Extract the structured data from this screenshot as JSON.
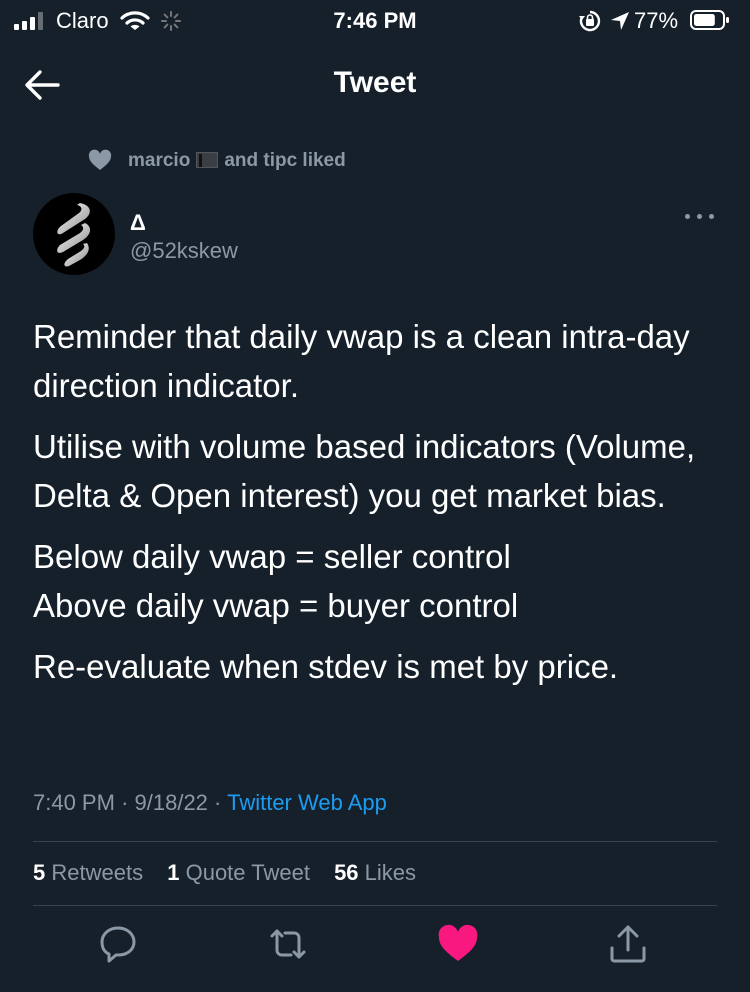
{
  "status_bar": {
    "carrier": "Claro",
    "time": "7:46 PM",
    "battery_percent": "77%",
    "battery_level": 0.77
  },
  "nav": {
    "title": "Tweet"
  },
  "social_context": {
    "liker1": "marcio",
    "liked_suffix": "and tipc liked"
  },
  "author": {
    "display_name": "Δ",
    "handle": "@52kskew"
  },
  "tweet": {
    "paragraphs": [
      "Reminder that daily vwap is a clean intra-day direction indicator.",
      "Utilise with volume based indicators (Volume, Delta & Open interest) you get market bias.",
      "Below daily vwap = seller control\nAbove daily vwap = buyer control",
      "Re-evaluate when stdev is met by price."
    ],
    "time": "7:40 PM",
    "date": "9/18/22",
    "source": "Twitter Web App",
    "sep": "·"
  },
  "stats": {
    "retweets_count": "5",
    "retweets_label": "Retweets",
    "quotes_count": "1",
    "quotes_label": "Quote Tweet",
    "likes_count": "56",
    "likes_label": "Likes"
  },
  "colors": {
    "background": "#15202b",
    "accent": "#1d9bf0",
    "like": "#f91880",
    "secondary_text": "#8b98a5"
  },
  "icons": [
    "signal-icon",
    "wifi-icon",
    "spinner-icon",
    "rotation-lock-icon",
    "location-arrow-icon",
    "battery-icon",
    "back-arrow-icon",
    "heart-icon",
    "more-icon",
    "reply-icon",
    "retweet-icon",
    "like-icon",
    "share-icon"
  ]
}
